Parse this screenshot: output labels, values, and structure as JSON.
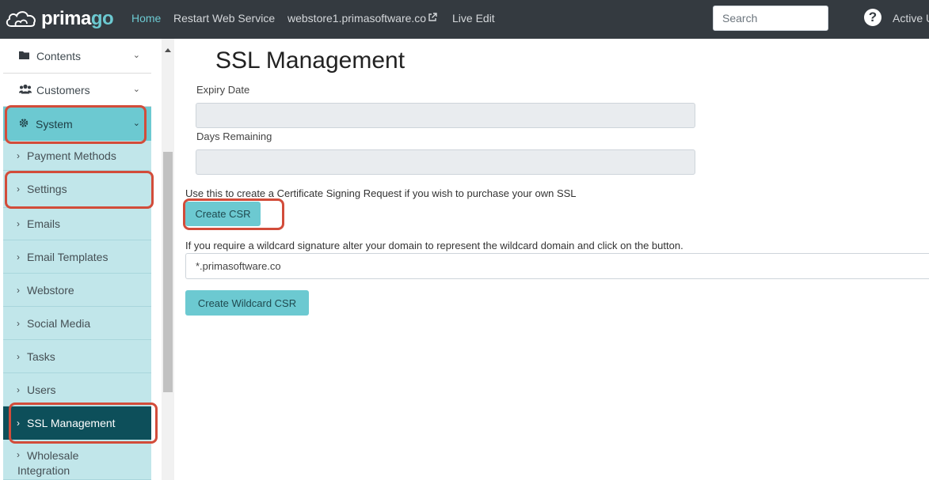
{
  "topnav": {
    "logo": {
      "text_main": "prima",
      "text_accent": "go"
    },
    "links": [
      "Home",
      "Restart Web Service",
      "webstore1.primasoftware.co",
      "Live Edit"
    ],
    "external_link_icon": "external-link-icon",
    "search_placeholder": "Search",
    "help_icon": "?",
    "user_label": "Active U"
  },
  "sidebar": {
    "top_items": [
      {
        "label": "Contents",
        "icon": "folder-icon"
      },
      {
        "label": "Customers",
        "icon": "users-icon"
      }
    ],
    "system": {
      "label": "System",
      "icon": "gear-icon"
    },
    "sub_items": [
      "Payment Methods",
      "Settings",
      "Emails",
      "Email Templates",
      "Webstore",
      "Social Media",
      "Tasks",
      "Users",
      "SSL Management",
      "Wholesale Integration"
    ],
    "current": "SSL Management",
    "wholesale_line1": "Wholesale",
    "wholesale_line2": "Integration",
    "glyphs": {
      "chevron": "⌄",
      "arrow": "›"
    }
  },
  "main": {
    "title": "SSL Management",
    "expiry_label": "Expiry Date",
    "expiry_value": "",
    "days_label": "Days Remaining",
    "days_value": "",
    "csr_info": "Use this to create a Certificate Signing Request if you wish to purchase your own SSL",
    "create_csr": "Create CSR",
    "wildcard_info": "If you require a wildcard signature alter your domain to represent the wildcard domain and click on the button.",
    "domain_value": "*.primasoftware.co",
    "create_wildcard": "Create Wildcard CSR"
  },
  "colors": {
    "topbar": "#343a40",
    "accent": "#6cc9d1",
    "submenu_bg": "#c1e6ea",
    "current_bg": "#0d4f5a",
    "highlight_ring": "#d24c3a"
  }
}
